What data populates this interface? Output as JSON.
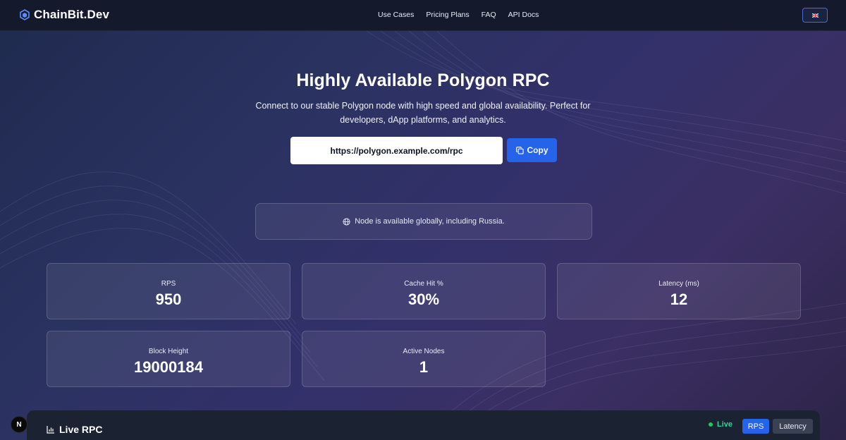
{
  "header": {
    "brand": "ChainBit.Dev",
    "nav": [
      "Use Cases",
      "Pricing Plans",
      "FAQ",
      "API Docs"
    ],
    "language_flag": "uk-flag-icon"
  },
  "hero": {
    "title": "Highly Available Polygon RPC",
    "subtitle": "Connect to our stable Polygon node with high speed and global availability. Perfect for developers, dApp platforms, and analytics.",
    "rpc_url": "https://polygon.example.com/rpc",
    "copy_label": "Copy",
    "notice": "Node is available globally, including Russia."
  },
  "stats": [
    {
      "label": "RPS",
      "value": "950"
    },
    {
      "label": "Cache Hit %",
      "value": "30%"
    },
    {
      "label": "Latency (ms)",
      "value": "12"
    },
    {
      "label": "Block Height",
      "value": "19000184"
    },
    {
      "label": "Active Nodes",
      "value": "1"
    }
  ],
  "live_panel": {
    "title": "Live RPC",
    "status": "Live",
    "tabs": [
      "RPS",
      "Latency"
    ],
    "active_tab": "RPS"
  },
  "badge": {
    "label": "N"
  },
  "colors": {
    "accent": "#2563eb",
    "live": "#22c55e",
    "topbar": "#141a2b"
  }
}
